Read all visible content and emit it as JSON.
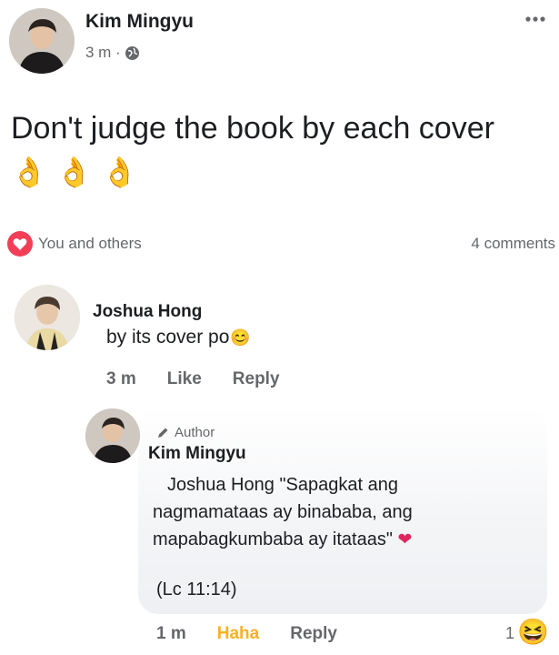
{
  "post": {
    "author": "Kim Mingyu",
    "time": "3 m ·",
    "more_icon": "more-dots-icon",
    "text": "Don't judge the book by each cover",
    "emojis": [
      "👌",
      "👌",
      "👌"
    ]
  },
  "reactions": {
    "icon": "heart-reaction-icon",
    "text": "You and others",
    "comments": "4 comments"
  },
  "comment": {
    "author": "Joshua Hong",
    "text": "by its cover po",
    "emoji": "😊",
    "time": "3 m",
    "like_label": "Like",
    "reply_label": "Reply"
  },
  "reply": {
    "badge": "Author",
    "author": "Kim Mingyu",
    "mention": "Joshua Hong",
    "line1": "\"Sapagkat ang",
    "line2": "nagmamataas ay binababa, ang",
    "line3": "mapabagkumbaba ay itataas\"",
    "heart": "❤",
    "reference": "(Lc 11:14)",
    "time": "1 m",
    "haha_label": "Haha",
    "reply_label": "Reply",
    "reaction_count": "1",
    "reaction_emoji": "😆"
  },
  "colors": {
    "accent_heart": "#f33e58",
    "secondary_text": "#65676b",
    "haha": "#f7b125"
  }
}
